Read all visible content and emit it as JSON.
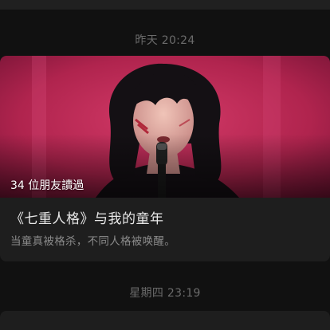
{
  "feed": {
    "timestamp_1": "昨天 20:24",
    "timestamp_2": "星期四 23:19",
    "article": {
      "read_count": "34 位朋友讀過",
      "title": "《七重人格》与我的童年",
      "summary": "当童真被格杀，不同人格被唤醒。"
    }
  },
  "colors": {
    "background": "#111111",
    "card": "#1e1e1e",
    "timestamp_text": "#6b6b6b",
    "title_text": "#e8e8e8",
    "summary_text": "#8a8a8a",
    "cover_bg": "#c02a55"
  }
}
